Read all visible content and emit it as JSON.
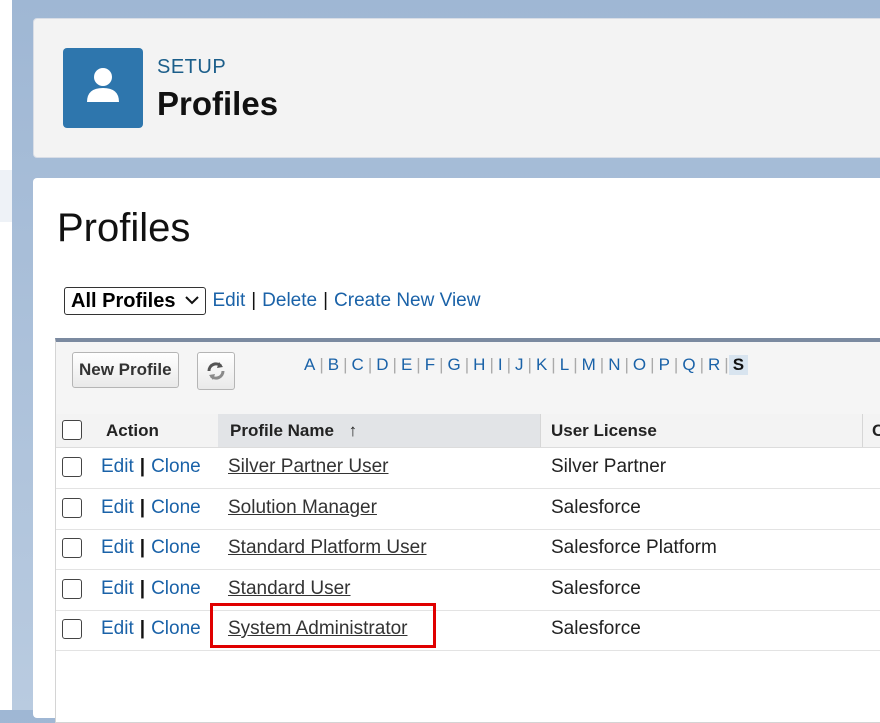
{
  "header": {
    "section_label": "SETUP",
    "title": "Profiles",
    "icon": "user-icon"
  },
  "main": {
    "title": "Profiles"
  },
  "view_bar": {
    "selected_view": "All Profiles",
    "edit_label": "Edit",
    "delete_label": "Delete",
    "create_label": "Create New View"
  },
  "toolbar": {
    "new_profile_label": "New Profile",
    "refresh_icon": "refresh-icon",
    "alphabet": [
      "A",
      "B",
      "C",
      "D",
      "E",
      "F",
      "G",
      "H",
      "I",
      "J",
      "K",
      "L",
      "M",
      "N",
      "O",
      "P",
      "Q",
      "R",
      "S"
    ],
    "active_letter": "S"
  },
  "table": {
    "columns": {
      "action": "Action",
      "profile_name": "Profile Name",
      "sort_indicator": "↑",
      "user_license": "User License",
      "next": "C"
    },
    "edit_label": "Edit",
    "clone_label": "Clone",
    "rows": [
      {
        "name": "Silver Partner User",
        "license": "Silver Partner"
      },
      {
        "name": "Solution Manager",
        "license": "Salesforce"
      },
      {
        "name": "Standard Platform User",
        "license": "Salesforce Platform"
      },
      {
        "name": "Standard User",
        "license": "Salesforce"
      },
      {
        "name": "System Administrator",
        "license": "Salesforce"
      }
    ]
  },
  "colors": {
    "link": "#1a62a8",
    "header_icon_bg": "#2e76ad",
    "highlight": "#e00000"
  }
}
